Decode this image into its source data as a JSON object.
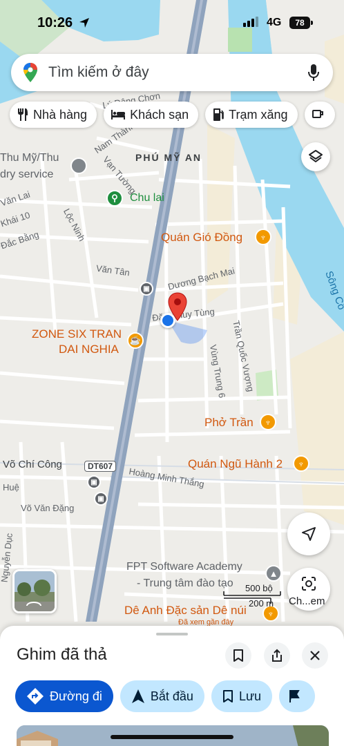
{
  "status_bar": {
    "time": "10:26",
    "network": "4G",
    "battery": "78"
  },
  "search": {
    "placeholder": "Tìm kiếm ở đây"
  },
  "chips": [
    {
      "label": "Nhà hàng",
      "icon": "fork-knife-icon"
    },
    {
      "label": "Khách sạn",
      "icon": "bed-icon"
    },
    {
      "label": "Trạm xăng",
      "icon": "gas-pump-icon"
    }
  ],
  "map": {
    "district": "PHÚ MỸ AN",
    "poi": {
      "chu_lai": "Chu lai",
      "quan_gio_dong": "Quán Gió Đồng",
      "zone_six_line1": "ZONE SIX TRAN",
      "zone_six_line2": "DAI NGHIA",
      "pho_tran": "Phở Trần",
      "quan_ngu_hanh": "Quán Ngũ Hành 2",
      "fpt_line1": "FPT Software Academy",
      "fpt_line2": "- Trung tâm đào tạo",
      "de_anh": "Dê Anh Đặc sản Dê núi",
      "de_anh_sub": "Đã xem gần đây",
      "thu_my_line1": "Thu Mỹ/Thu",
      "thu_my_line2": "dry service"
    },
    "streets": {
      "duong_bach_mai": "Dương Bạch Mai",
      "dang_huy_tung": "Đặng Huy Tùng",
      "tran_quoc_vuong": "Trần Quốc Vượng",
      "vung_trung_6": "Vùng Trung 6",
      "van_tan": "Văn Tân",
      "loc_ninh": "Lộc Ninh",
      "van_tuong": "Vạn Tường",
      "nam_thanh": "Nam Thành",
      "vo_chi_cong": "Võ Chí Công",
      "dt607": "DT607",
      "hoang_minh_thang": "Hoàng Minh Thắng",
      "vo_van_dang": "Võ Văn Đặng",
      "hue": "Huệ",
      "nguyen_duc": "Nguyễn Dục",
      "van_lai": "Văn Lai",
      "khai_10": "Khái 10",
      "dac_bang": "Đắc Bằng",
      "ly_dong_chon": "Lý Đông Chơn",
      "song_co": "Sông Cổ"
    },
    "scale": {
      "top": "500 bộ",
      "bottom": "200 m"
    }
  },
  "lens_button": {
    "label": "Ch...em"
  },
  "sheet": {
    "title": "Ghim đã thả",
    "actions": [
      {
        "label": "Đường đi"
      },
      {
        "label": "Bắt đầu"
      },
      {
        "label": "Lưu"
      }
    ]
  },
  "colors": {
    "river": "#9ad8f0",
    "highway": "#8fa3bd",
    "pin_red": "#ea4335",
    "location_blue": "#1a73e8",
    "primary_button": "#0b57d0",
    "tonal_button": "#c2e7ff",
    "poi_orange": "#d1580f"
  }
}
